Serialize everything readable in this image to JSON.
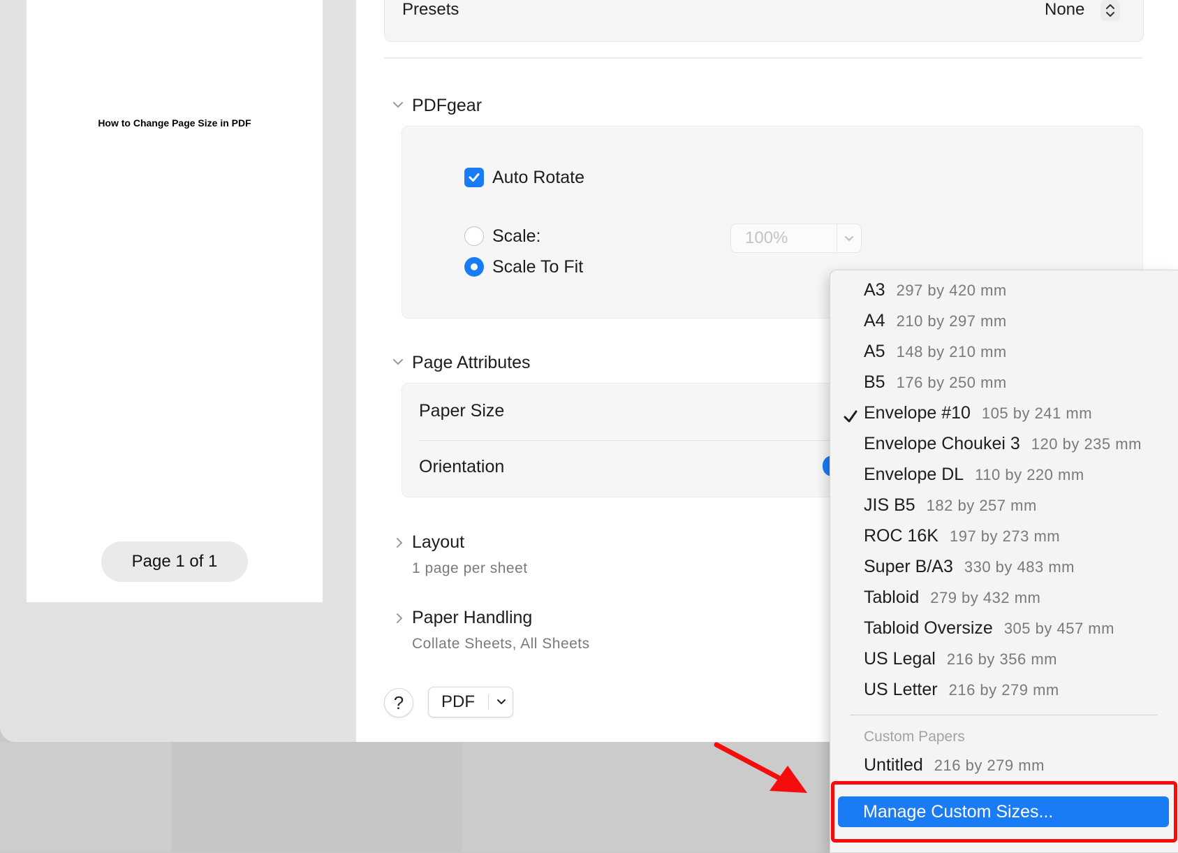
{
  "preview": {
    "page_title": "How to Change Page Size in PDF",
    "page_indicator": "Page 1 of 1"
  },
  "presets": {
    "label": "Presets",
    "value": "None"
  },
  "pdfgear": {
    "title": "PDFgear",
    "auto_rotate": {
      "label": "Auto Rotate",
      "checked": true
    },
    "scale": {
      "label": "Scale:",
      "selected": false,
      "value": "100%"
    },
    "scale_to_fit": {
      "label": "Scale To Fit",
      "selected": true
    }
  },
  "page_attributes": {
    "title": "Page Attributes",
    "paper_size_label": "Paper Size",
    "orientation_label": "Orientation"
  },
  "layout": {
    "title": "Layout",
    "summary": "1 page per sheet"
  },
  "paper_handling": {
    "title": "Paper Handling",
    "summary": "Collate Sheets, All Sheets"
  },
  "footer": {
    "help": "?",
    "pdf_label": "PDF"
  },
  "paper_menu": {
    "items": [
      {
        "name": "A3",
        "dims": "297 by 420 mm",
        "checked": false
      },
      {
        "name": "A4",
        "dims": "210 by 297 mm",
        "checked": false
      },
      {
        "name": "A5",
        "dims": "148 by 210 mm",
        "checked": false
      },
      {
        "name": "B5",
        "dims": "176 by 250 mm",
        "checked": false
      },
      {
        "name": "Envelope #10",
        "dims": "105 by 241 mm",
        "checked": true
      },
      {
        "name": "Envelope Choukei 3",
        "dims": "120 by 235 mm",
        "checked": false
      },
      {
        "name": "Envelope DL",
        "dims": "110 by 220 mm",
        "checked": false
      },
      {
        "name": "JIS B5",
        "dims": "182 by 257 mm",
        "checked": false
      },
      {
        "name": "ROC 16K",
        "dims": "197 by 273 mm",
        "checked": false
      },
      {
        "name": "Super B/A3",
        "dims": "330 by 483 mm",
        "checked": false
      },
      {
        "name": "Tabloid",
        "dims": "279 by 432 mm",
        "checked": false
      },
      {
        "name": "Tabloid Oversize",
        "dims": "305 by 457 mm",
        "checked": false
      },
      {
        "name": "US Legal",
        "dims": "216 by 356 mm",
        "checked": false
      },
      {
        "name": "US Letter",
        "dims": "216 by 279 mm",
        "checked": false
      }
    ],
    "custom_header": "Custom Papers",
    "custom_items": [
      {
        "name": "Untitled",
        "dims": "216 by 279 mm"
      }
    ],
    "manage_label": "Manage Custom Sizes..."
  },
  "colors": {
    "accent": "#1a7cf5",
    "annotation_red": "#f50d0d",
    "menu_background": "#f4f4f4"
  }
}
